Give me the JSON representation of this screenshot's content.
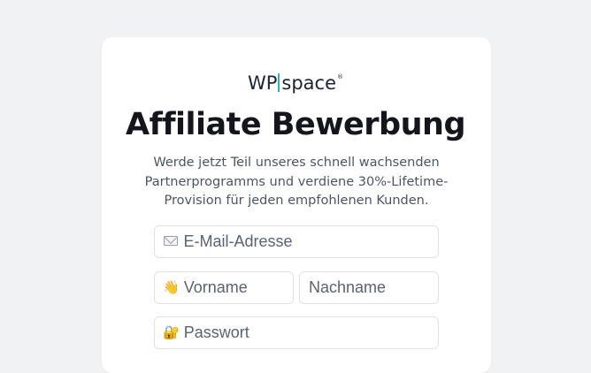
{
  "brand": {
    "logo_wp": "WP",
    "logo_space": "space",
    "logo_reg": "®",
    "accent_color": "#2db7b0"
  },
  "page": {
    "title": "Affiliate Bewerbung",
    "subtitle": "Werde jetzt Teil unseres schnell wachsenden Partnerprogramms und verdiene 30%-Lifetime-Provision für jeden empfohlenen Kunden."
  },
  "form": {
    "email": {
      "placeholder": "E-Mail-Adresse",
      "icon": "envelope-icon",
      "value": ""
    },
    "first_name": {
      "placeholder": "Vorname",
      "icon": "waving-hand-icon",
      "glyph": "👋",
      "value": ""
    },
    "last_name": {
      "placeholder": "Nachname",
      "value": ""
    },
    "password": {
      "placeholder": "Passwort",
      "icon": "lock-with-key-icon",
      "glyph": "🔐",
      "value": ""
    }
  }
}
